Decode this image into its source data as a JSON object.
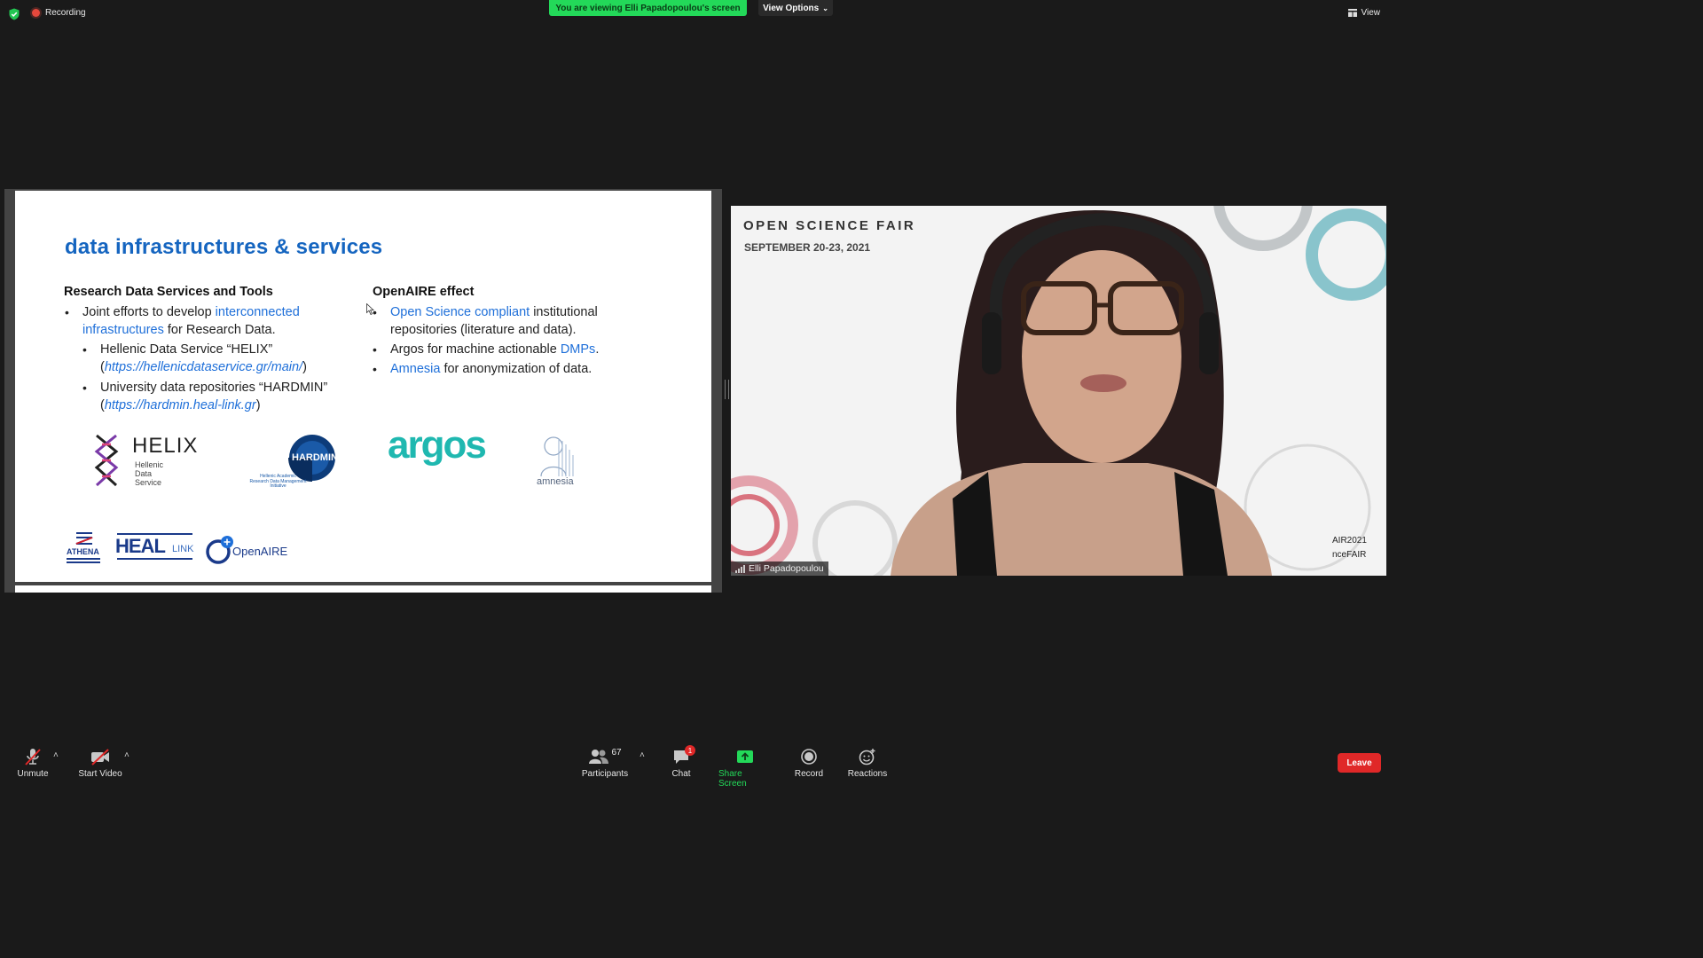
{
  "topbar": {
    "recording_label": "Recording",
    "viewing_banner": "You are viewing Elli Papadopoulou's screen",
    "view_options_label": "View Options",
    "view_label": "View"
  },
  "slide": {
    "title": "data infrastructures & services",
    "left_heading": "Research Data Services and Tools",
    "left_b1_pre": "Joint efforts to develop ",
    "left_b1_link": "interconnected infrastructures",
    "left_b1_post": " for Research Data.",
    "left_s1_pre": "Hellenic Data Service “HELIX” (",
    "left_s1_link": "https://hellenicdataservice.gr/main/",
    "left_s1_post": ")",
    "left_s2_pre": "University data repositories “HARDMIN” (",
    "left_s2_link": "https://hardmin.heal-link.gr",
    "left_s2_post": ")",
    "right_heading": "OpenAIRE effect",
    "right_b1_link": "Open Science compliant",
    "right_b1_post": " institutional repositories (literature and data).",
    "right_b2_pre": "Argos for machine actionable ",
    "right_b2_link": "DMPs",
    "right_b2_post": ".",
    "right_b3_link": "Amnesia",
    "right_b3_post": " for anonymization of data.",
    "logos": {
      "helix_name": "HELIX",
      "helix_sub1": "Hellenic",
      "helix_sub2": "Data",
      "helix_sub3": "Service",
      "hardmin": "HARDMIN",
      "hardmin_sub1": "Hellenic Academic",
      "hardmin_sub2": "Research Data Management",
      "hardmin_sub3": "Initiative",
      "argos": "argos",
      "amnesia": "amnesia",
      "athena": "ATHENA",
      "heal": "HEAL",
      "heal_link": "LINK",
      "openaire": "OpenAIRE"
    },
    "colors": {
      "title": "#1565c0",
      "link": "#1e6fd9",
      "argos": "#1fb8b0"
    }
  },
  "video": {
    "event_title": "OPEN SCIENCE FAIR",
    "event_dates": "SEPTEMBER 20-23, 2021",
    "corner_text1": "AIR2021",
    "corner_text2": "nceFAIR",
    "participant_name": "Elli Papadopoulou"
  },
  "toolbar": {
    "unmute": "Unmute",
    "start_video": "Start Video",
    "participants": "Participants",
    "participants_count": "67",
    "chat": "Chat",
    "chat_badge": "1",
    "share_screen": "Share Screen",
    "record": "Record",
    "reactions": "Reactions",
    "leave": "Leave"
  }
}
